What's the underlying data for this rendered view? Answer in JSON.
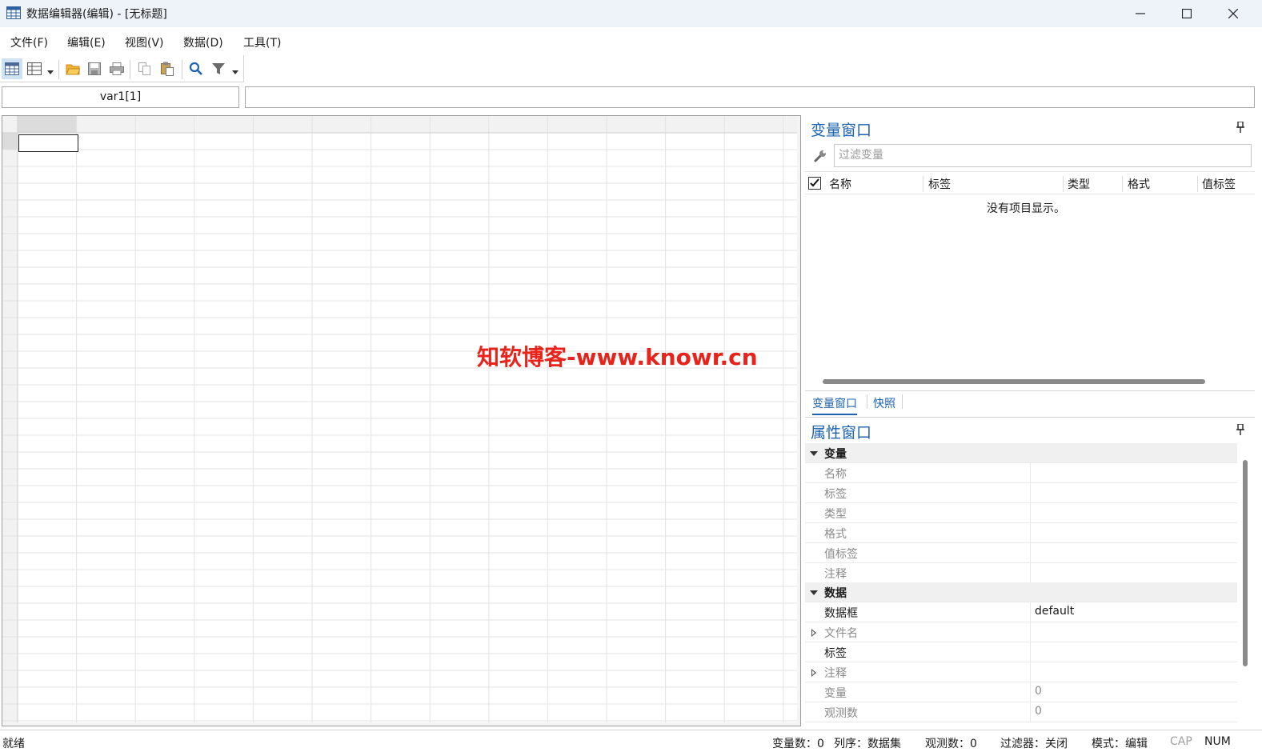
{
  "window": {
    "title": "数据编辑器(编辑) - [无标题]"
  },
  "menu": [
    "文件(F)",
    "编辑(E)",
    "视图(V)",
    "数据(D)",
    "工具(T)"
  ],
  "toolbar": {
    "icons": [
      "data-editor-icon",
      "variable-view-icon",
      "open-folder-icon",
      "save-icon",
      "print-icon",
      "copy-icon",
      "paste-icon",
      "search-icon",
      "filter-icon"
    ]
  },
  "cell": {
    "name": "var1[1]",
    "value": ""
  },
  "watermark": "知软博客-www.knowr.cn",
  "variables_panel": {
    "title": "变量窗口",
    "filter_placeholder": "过滤变量",
    "columns": [
      "名称",
      "标签",
      "类型",
      "格式",
      "值标签"
    ],
    "empty_text": "没有项目显示。"
  },
  "tabs": [
    "变量窗口",
    "快照"
  ],
  "properties_panel": {
    "title": "属性窗口",
    "categories": {
      "variable": {
        "label": "变量",
        "rows": [
          {
            "name": "名称",
            "value": ""
          },
          {
            "name": "标签",
            "value": ""
          },
          {
            "name": "类型",
            "value": ""
          },
          {
            "name": "格式",
            "value": ""
          },
          {
            "name": "值标签",
            "value": ""
          },
          {
            "name": "注释",
            "value": ""
          }
        ]
      },
      "data": {
        "label": "数据",
        "rows": [
          {
            "name": "数据框",
            "value": "default"
          },
          {
            "name": "文件名",
            "value": ""
          },
          {
            "name": "标签",
            "value": ""
          },
          {
            "name": "注释",
            "value": ""
          },
          {
            "name": "变量",
            "value": "0"
          },
          {
            "name": "观测数",
            "value": "0"
          }
        ]
      }
    }
  },
  "status": {
    "ready": "就绪",
    "var_count": "变量数：0",
    "order": "列序：数据集",
    "obs_count": "观测数：0",
    "filter": "过滤器：关闭",
    "mode": "模式：编辑",
    "cap": "CAP",
    "num": "NUM"
  },
  "colors": {
    "accent": "#1e63b0",
    "watermark": "#e8231c",
    "titlebar": "#eef3fa"
  }
}
